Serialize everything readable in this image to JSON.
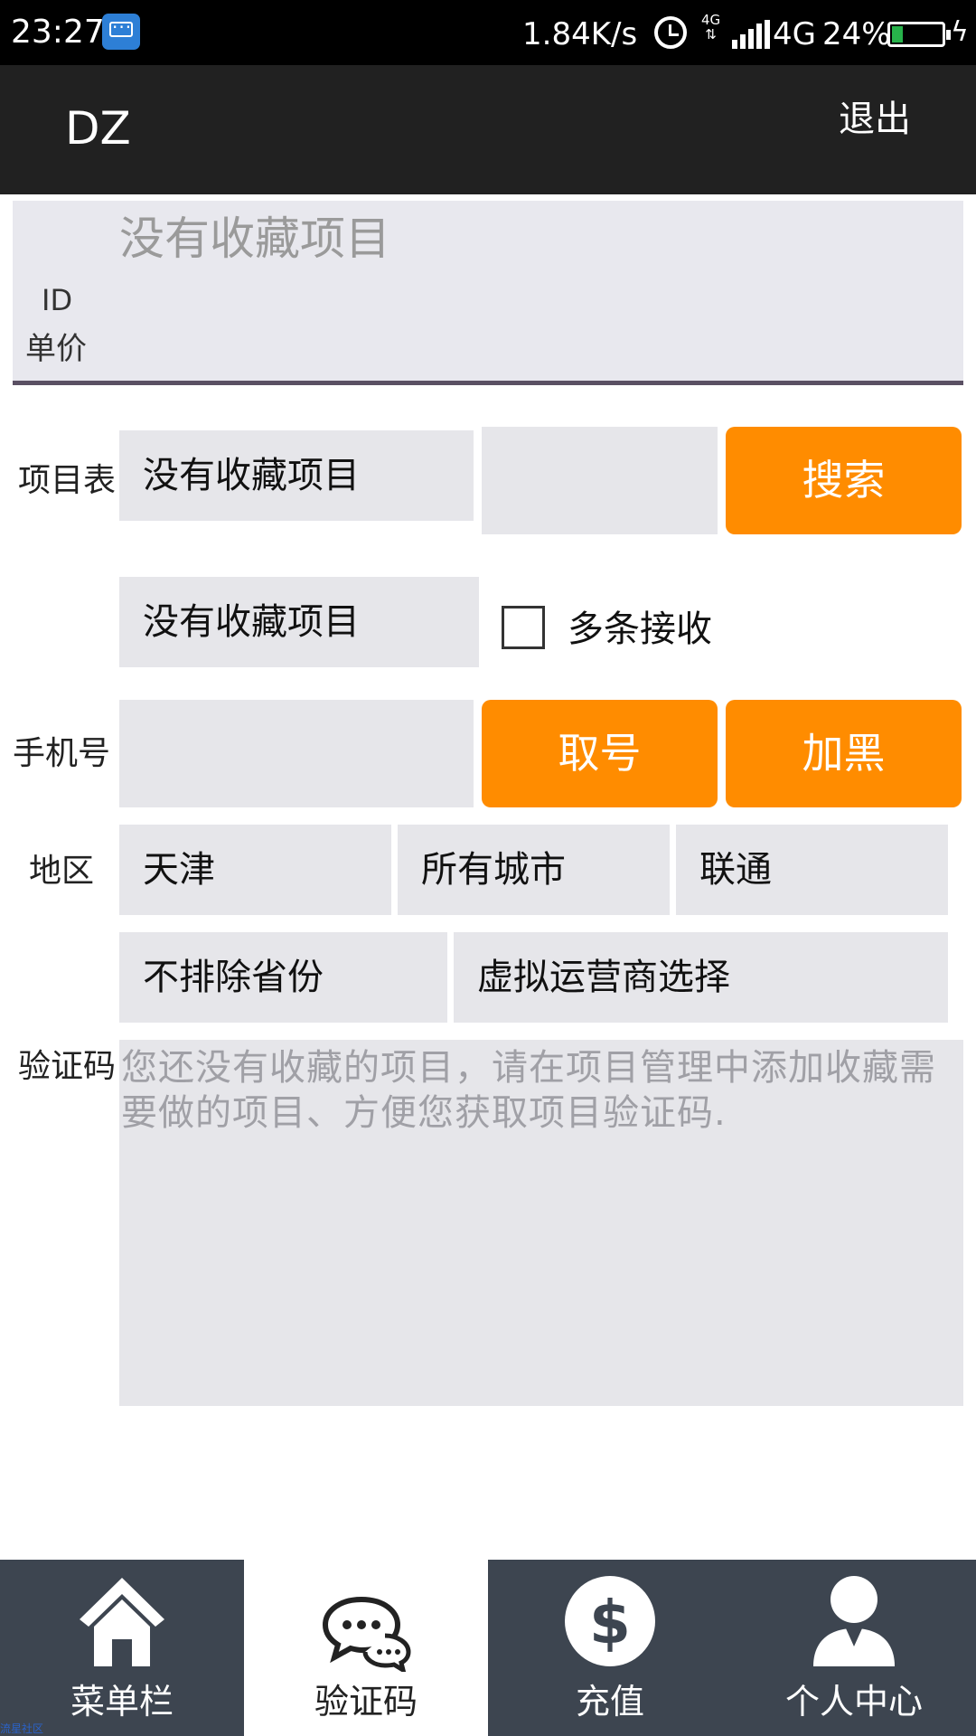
{
  "status_bar": {
    "time": "23:27",
    "net_speed": "1.84K/s",
    "network_small": "4G",
    "network": "4G",
    "battery": "24%"
  },
  "app_bar": {
    "title": "DZ",
    "logout_label": "退出"
  },
  "favorite": {
    "placeholder": "没有收藏项目",
    "id_label": "ID",
    "price_label": "单价"
  },
  "form": {
    "project_label": "项目表",
    "project_spinner": "没有收藏项目",
    "project_search_value": "",
    "search_button": "搜索",
    "project_spinner2": "没有收藏项目",
    "multi_receive_label": "多条接收",
    "multi_receive_checked": false,
    "phone_label": "手机号",
    "phone_value": "",
    "get_number_button": "取号",
    "blacklist_button": "加黑",
    "region_label": "地区",
    "province": "天津",
    "city": "所有城市",
    "carrier": "联通",
    "exclude_province": "不排除省份",
    "virtual_operator": "虚拟运营商选择",
    "code_label": "验证码",
    "code_placeholder": "您还没有收藏的项目，请在项目管理中添加收藏需要做的项目、方便您获取项目验证码."
  },
  "bottom_nav": [
    {
      "label": "菜单栏",
      "icon": "home-icon",
      "active": false
    },
    {
      "label": "验证码",
      "icon": "chat-icon",
      "active": true
    },
    {
      "label": "充值",
      "icon": "dollar-icon",
      "active": false
    },
    {
      "label": "个人中心",
      "icon": "user-icon",
      "active": false
    }
  ],
  "watermark": "流星社区",
  "colors": {
    "accent": "#ff8c00",
    "app_bar": "#212121",
    "nav_dark": "#3d4550",
    "field_bg": "#e6e6ea"
  }
}
